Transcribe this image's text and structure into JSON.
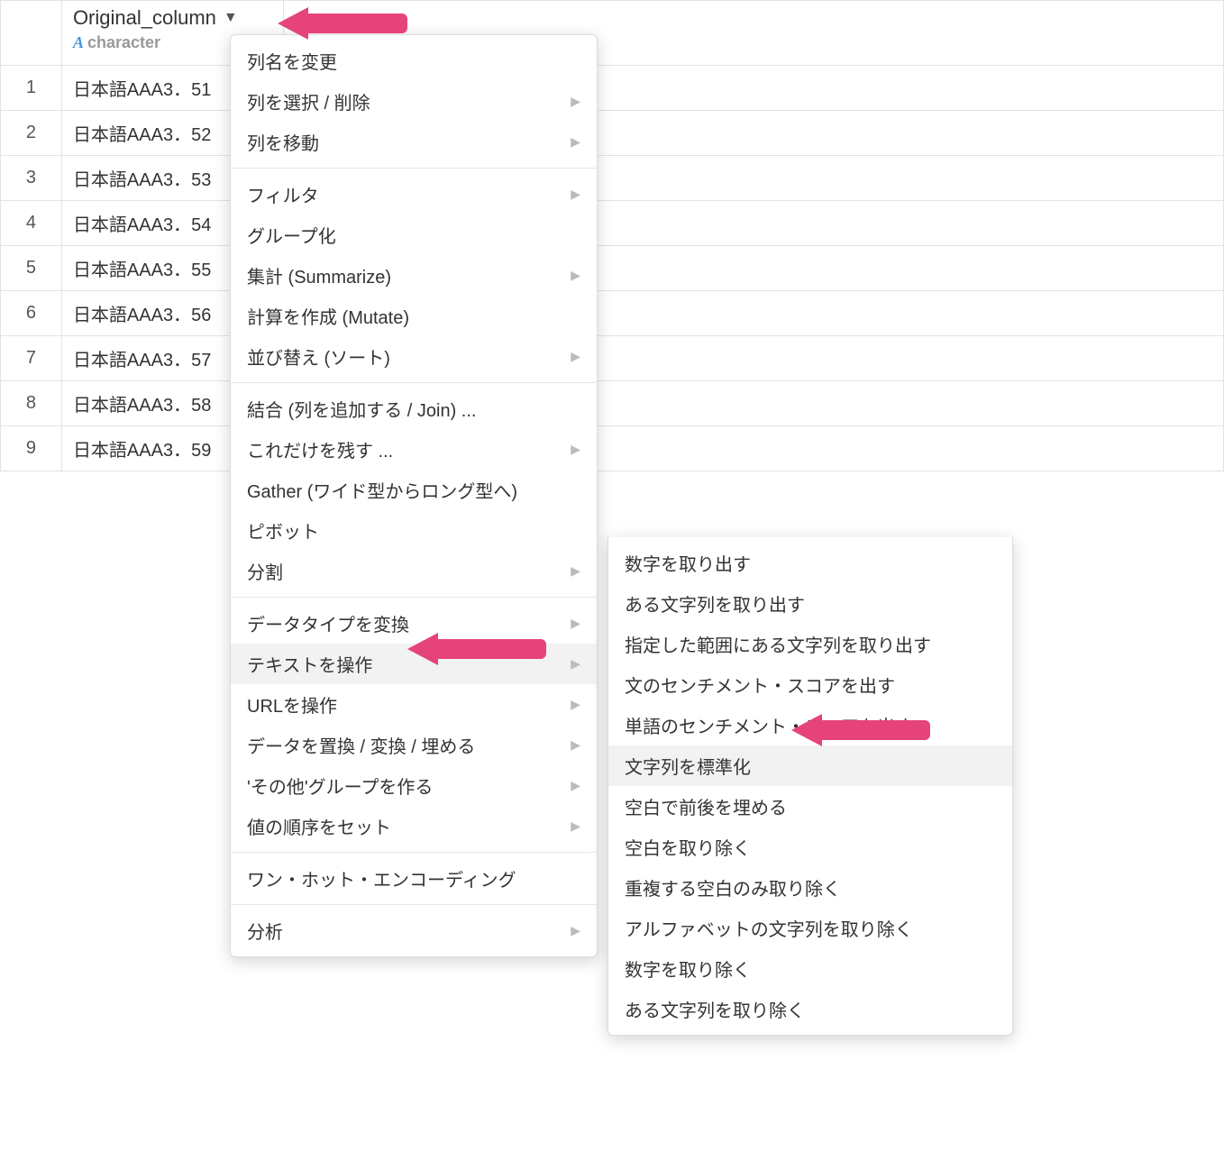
{
  "column": {
    "name": "Original_column",
    "type": "character"
  },
  "rows": [
    {
      "n": "1",
      "v": "日本語AAA3．51"
    },
    {
      "n": "2",
      "v": "日本語AAA3．52"
    },
    {
      "n": "3",
      "v": "日本語AAA3．53"
    },
    {
      "n": "4",
      "v": "日本語AAA3．54"
    },
    {
      "n": "5",
      "v": "日本語AAA3．55"
    },
    {
      "n": "6",
      "v": "日本語AAA3．56"
    },
    {
      "n": "7",
      "v": "日本語AAA3．57"
    },
    {
      "n": "8",
      "v": "日本語AAA3．58"
    },
    {
      "n": "9",
      "v": "日本語AAA3．59"
    }
  ],
  "menu1": {
    "g0": [
      {
        "label": "列名を変更",
        "sub": false
      },
      {
        "label": "列を選択 / 削除",
        "sub": true
      },
      {
        "label": "列を移動",
        "sub": true
      }
    ],
    "g1": [
      {
        "label": "フィルタ",
        "sub": true
      },
      {
        "label": "グループ化",
        "sub": false
      },
      {
        "label": "集計 (Summarize)",
        "sub": true
      },
      {
        "label": "計算を作成 (Mutate)",
        "sub": false
      },
      {
        "label": "並び替え (ソート)",
        "sub": true
      }
    ],
    "g2": [
      {
        "label": "結合 (列を追加する / Join) ...",
        "sub": false
      },
      {
        "label": "これだけを残す ...",
        "sub": true
      },
      {
        "label": "Gather (ワイド型からロング型へ)",
        "sub": false
      },
      {
        "label": "ピボット",
        "sub": false
      },
      {
        "label": "分割",
        "sub": true
      }
    ],
    "g3": [
      {
        "label": "データタイプを変換",
        "sub": true
      },
      {
        "label": "テキストを操作",
        "sub": true,
        "hovered": true
      },
      {
        "label": "URLを操作",
        "sub": true
      },
      {
        "label": "データを置換 / 変換 / 埋める",
        "sub": true
      },
      {
        "label": "'その他'グループを作る",
        "sub": true
      },
      {
        "label": "値の順序をセット",
        "sub": true
      }
    ],
    "g4": [
      {
        "label": "ワン・ホット・エンコーディング",
        "sub": false
      }
    ],
    "g5": [
      {
        "label": "分析",
        "sub": true
      }
    ]
  },
  "menu2": [
    {
      "label": "数字を取り出す"
    },
    {
      "label": "ある文字列を取り出す"
    },
    {
      "label": "指定した範囲にある文字列を取り出す"
    },
    {
      "label": "文のセンチメント・スコアを出す"
    },
    {
      "label": "単語のセンチメント・スコアを出す"
    },
    {
      "label": "文字列を標準化",
      "hovered": true
    },
    {
      "label": "空白で前後を埋める"
    },
    {
      "label": "空白を取り除く"
    },
    {
      "label": "重複する空白のみ取り除く"
    },
    {
      "label": "アルファベットの文字列を取り除く"
    },
    {
      "label": "数字を取り除く"
    },
    {
      "label": "ある文字列を取り除く"
    }
  ]
}
